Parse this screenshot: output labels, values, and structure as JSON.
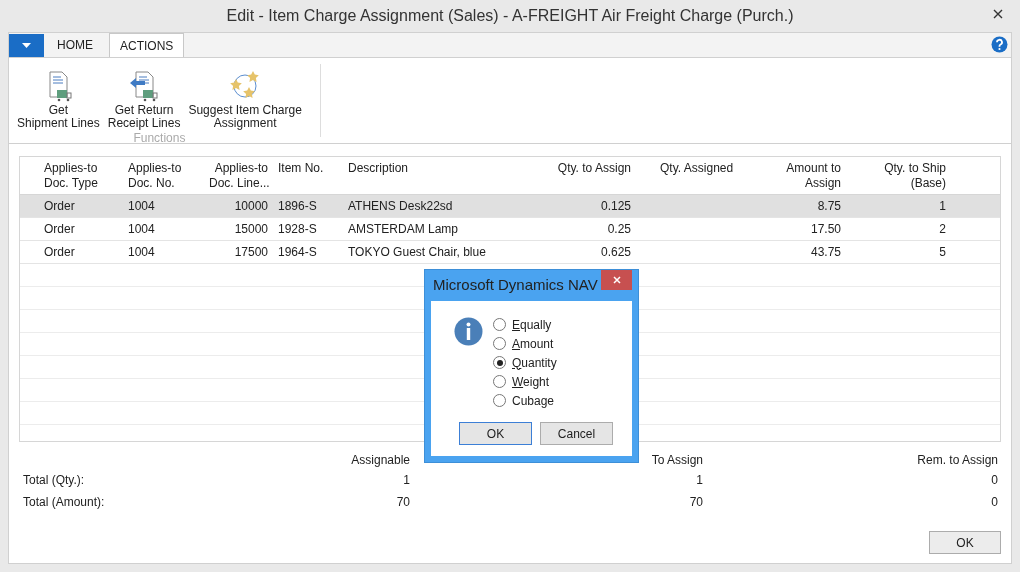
{
  "window": {
    "title": "Edit - Item Charge Assignment (Sales) - A-FREIGHT Air Freight Charge (Purch.)"
  },
  "ribbon": {
    "tabs": [
      {
        "label": "HOME",
        "selected": false
      },
      {
        "label": "ACTIONS",
        "selected": true
      }
    ],
    "group": {
      "label": "Functions",
      "actions": [
        {
          "kind": "shipment",
          "label": "Get\nShipment Lines"
        },
        {
          "kind": "return",
          "label": "Get Return\nReceipt Lines"
        },
        {
          "kind": "suggest",
          "label": "Suggest Item Charge\nAssignment"
        }
      ]
    }
  },
  "table": {
    "columns": [
      "Applies-to\nDoc. Type",
      "Applies-to\nDoc. No.",
      "Applies-to\nDoc. Line...",
      "Item No.",
      "Description",
      "Qty. to Assign",
      "Qty. Assigned",
      "Amount to\nAssign",
      "Qty. to Ship\n(Base)"
    ],
    "rows": [
      {
        "selected": true,
        "cells": [
          "Order",
          "1004",
          "10000",
          "1896-S",
          "ATHENS Desk22sd",
          "0.125",
          "",
          "8.75",
          "1"
        ]
      },
      {
        "selected": false,
        "cells": [
          "Order",
          "1004",
          "15000",
          "1928-S",
          "AMSTERDAM Lamp",
          "0.25",
          "",
          "17.50",
          "2"
        ]
      },
      {
        "selected": false,
        "cells": [
          "Order",
          "1004",
          "17500",
          "1964-S",
          "TOKYO Guest Chair, blue",
          "0.625",
          "",
          "43.75",
          "5"
        ]
      }
    ]
  },
  "totals": {
    "columns": [
      "Assignable",
      "To Assign",
      "Rem. to Assign"
    ],
    "rows": [
      {
        "label": "Total (Qty.):",
        "values": [
          "1",
          "1",
          "0"
        ]
      },
      {
        "label": "Total (Amount):",
        "values": [
          "70",
          "70",
          "0"
        ]
      }
    ]
  },
  "ok_button": "OK",
  "dialog": {
    "title": "Microsoft Dynamics NAV",
    "options": [
      {
        "label": "Equally",
        "underline_first": true,
        "selected": false
      },
      {
        "label": "Amount",
        "underline_first": true,
        "selected": false
      },
      {
        "label": "Quantity",
        "underline_first": true,
        "selected": true
      },
      {
        "label": "Weight",
        "underline_first": true,
        "selected": false
      },
      {
        "label": "Cubage",
        "underline_first": false,
        "selected": false
      }
    ],
    "buttons": [
      "OK",
      "Cancel"
    ]
  }
}
